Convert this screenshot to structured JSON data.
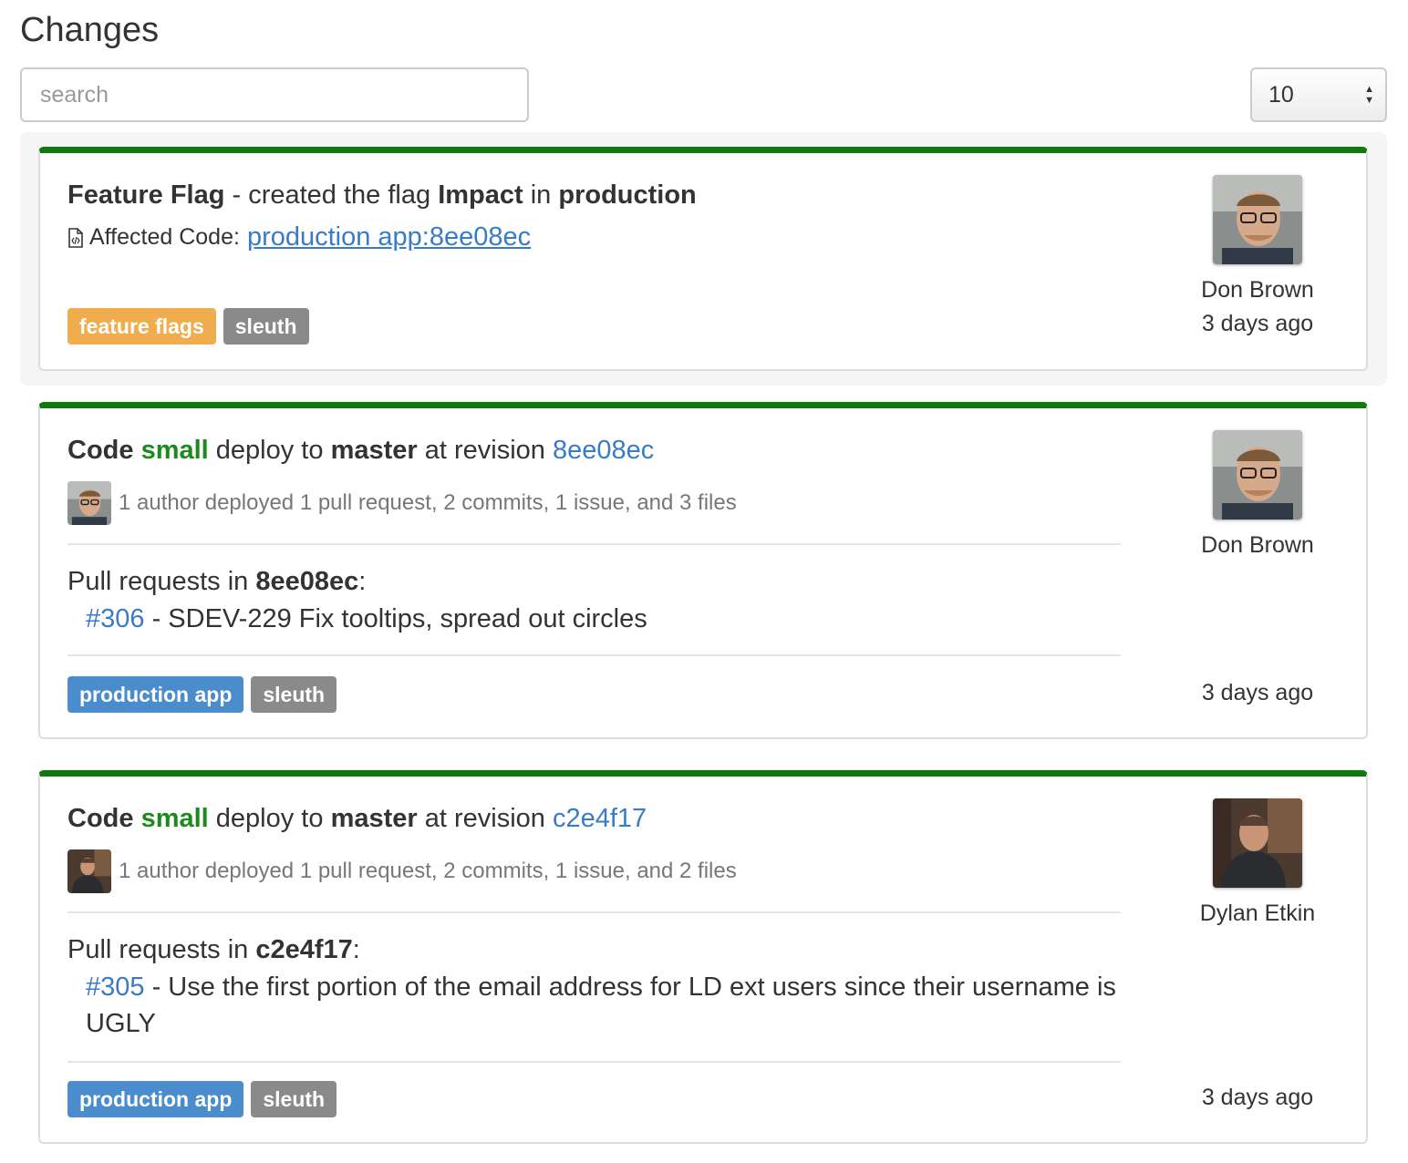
{
  "page": {
    "title": "Changes",
    "search_placeholder": "search",
    "page_size": "10"
  },
  "colors": {
    "card_top_border": "#10780f",
    "link": "#3a7bc8",
    "size_green": "#1e8a1e",
    "label_feature_flags": "#f0ad4e",
    "label_sleuth": "#8a8a8a",
    "label_production_app": "#4a8ccc"
  },
  "cards": [
    {
      "type_label": "Feature Flag",
      "sep": " - created the flag ",
      "flag_name": "Impact",
      "in_word": " in ",
      "environment": "production",
      "affected_label": "Affected Code:",
      "affected_link": "production app:8ee08ec",
      "labels": [
        "feature flags",
        "sleuth"
      ],
      "author": "Don Brown",
      "time": "3 days ago"
    },
    {
      "code_word": "Code",
      "size": "small",
      "deploy_to": " deploy to ",
      "branch": "master",
      "at_revision": " at revision ",
      "revision": "8ee08ec",
      "summary": "1 author deployed 1 pull request, 2 commits, 1 issue, and 3 files",
      "pr_heading_prefix": "Pull requests in ",
      "pr_revision": "8ee08ec",
      "pr_heading_suffix": ":",
      "pr_number": "#306",
      "pr_title": " - SDEV-229 Fix tooltips, spread out circles",
      "labels": [
        "production app",
        "sleuth"
      ],
      "author": "Don Brown",
      "time": "3 days ago"
    },
    {
      "code_word": "Code",
      "size": "small",
      "deploy_to": " deploy to ",
      "branch": "master",
      "at_revision": " at revision ",
      "revision": "c2e4f17",
      "summary": "1 author deployed 1 pull request, 2 commits, 1 issue, and 2 files",
      "pr_heading_prefix": "Pull requests in ",
      "pr_revision": "c2e4f17",
      "pr_heading_suffix": ":",
      "pr_number": "#305",
      "pr_title": " - Use the first portion of the email address for LD ext users since their username is UGLY",
      "labels": [
        "production app",
        "sleuth"
      ],
      "author": "Dylan Etkin",
      "time": "3 days ago"
    }
  ]
}
